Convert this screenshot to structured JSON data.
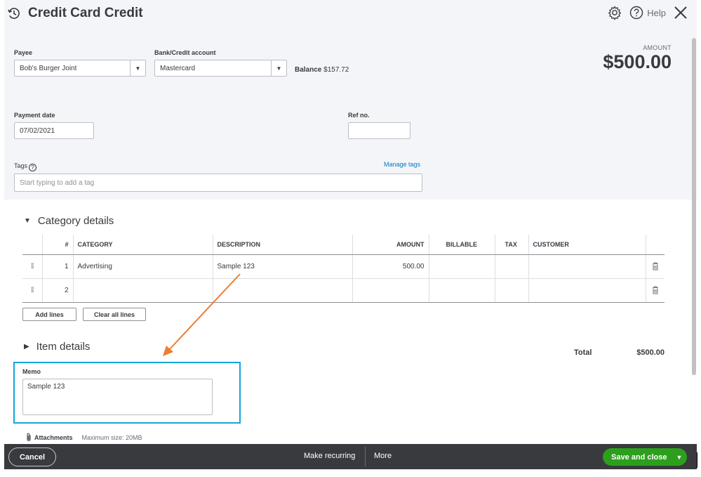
{
  "header": {
    "title": "Credit Card Credit",
    "help_label": "Help"
  },
  "payee": {
    "label": "Payee",
    "value": "Bob's Burger Joint"
  },
  "bank_account": {
    "label": "Bank/Credit account",
    "value": "Mastercard",
    "balance_label": "Balance",
    "balance_value": "$157.72"
  },
  "amount": {
    "label": "AMOUNT",
    "value": "$500.00"
  },
  "payment_date": {
    "label": "Payment date",
    "value": "07/02/2021"
  },
  "ref_no": {
    "label": "Ref no.",
    "value": ""
  },
  "tags": {
    "label": "Tags",
    "manage_link": "Manage tags",
    "placeholder": "Start typing to add a tag"
  },
  "category_details": {
    "title": "Category details",
    "columns": [
      "#",
      "CATEGORY",
      "DESCRIPTION",
      "AMOUNT",
      "BILLABLE",
      "TAX",
      "CUSTOMER"
    ],
    "rows": [
      {
        "num": "1",
        "category": "Advertising",
        "description": "Sample 123",
        "amount": "500.00",
        "billable": "",
        "tax": "",
        "customer": ""
      },
      {
        "num": "2",
        "category": "",
        "description": "",
        "amount": "",
        "billable": "",
        "tax": "",
        "customer": ""
      }
    ],
    "add_lines_label": "Add lines",
    "clear_lines_label": "Clear all lines"
  },
  "item_details": {
    "title": "Item details"
  },
  "total": {
    "label": "Total",
    "value": "$500.00"
  },
  "memo": {
    "label": "Memo",
    "value": "Sample 123"
  },
  "attachments": {
    "label": "Attachments",
    "max_size": "Maximum size: 20MB"
  },
  "footer": {
    "cancel_label": "Cancel",
    "make_recurring_label": "Make recurring",
    "more_label": "More",
    "save_label": "Save and close"
  },
  "colors": {
    "header_bg": "#f4f5f8",
    "footer_bg": "#393a3d",
    "save_green": "#2ca01c",
    "highlight_blue": "#15a4dc",
    "arrow_orange": "#ed7d31",
    "link_blue": "#0077c5"
  },
  "icons": [
    "history-icon",
    "gear-icon",
    "help-icon",
    "close-icon",
    "drag-handle-icon",
    "trash-icon",
    "paperclip-icon",
    "caret-down-icon",
    "triangle-down-icon",
    "triangle-right-icon"
  ]
}
